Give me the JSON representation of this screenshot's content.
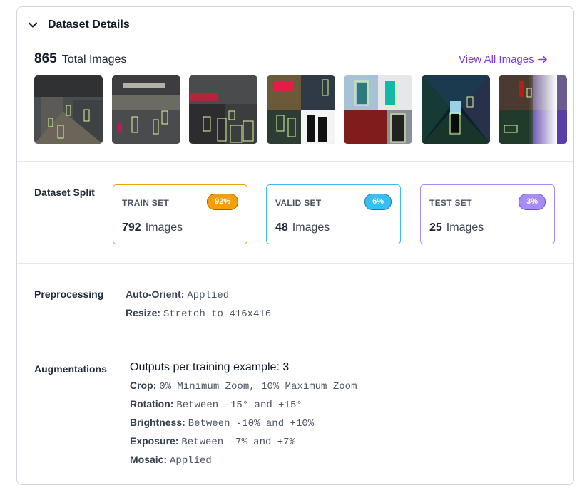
{
  "header": {
    "title": "Dataset Details"
  },
  "summary": {
    "total_count": "865",
    "total_label": "Total Images",
    "view_all": "View All Images"
  },
  "dataset_split": {
    "label": "Dataset Split",
    "sets": [
      {
        "name": "TRAIN SET",
        "percent": "92%",
        "count": "792",
        "unit": "Images",
        "color": "#f59e0b",
        "badge_color": "#f59e0b"
      },
      {
        "name": "VALID SET",
        "percent": "6%",
        "count": "48",
        "unit": "Images",
        "color": "#38bdf8",
        "badge_color": "#38bdf8"
      },
      {
        "name": "TEST SET",
        "percent": "3%",
        "count": "25",
        "unit": "Images",
        "color": "#a78bfa",
        "badge_color": "#a78bfa"
      }
    ]
  },
  "preprocessing": {
    "label": "Preprocessing",
    "items": [
      {
        "key": "Auto-Orient:",
        "value": "Applied"
      },
      {
        "key": "Resize:",
        "value": "Stretch to 416x416"
      }
    ]
  },
  "augmentations": {
    "label": "Augmentations",
    "outputs": "Outputs per training example: 3",
    "items": [
      {
        "key": "Crop:",
        "value": "0% Minimum Zoom, 10% Maximum Zoom"
      },
      {
        "key": "Rotation:",
        "value": "Between -15° and +15°"
      },
      {
        "key": "Brightness:",
        "value": "Between -10% and +10%"
      },
      {
        "key": "Exposure:",
        "value": "Between -7% and +7%"
      },
      {
        "key": "Mosaic:",
        "value": "Applied"
      }
    ]
  },
  "colors": {
    "accent": "#7c3aed",
    "box_annotation": "#d9f99d"
  }
}
